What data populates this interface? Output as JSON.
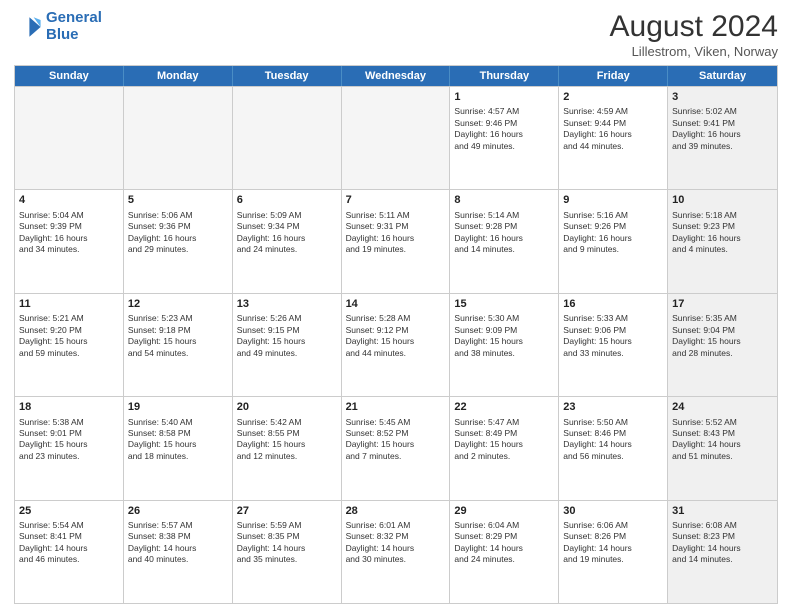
{
  "logo": {
    "line1": "General",
    "line2": "Blue"
  },
  "title": "August 2024",
  "subtitle": "Lillestrom, Viken, Norway",
  "header": {
    "days": [
      "Sunday",
      "Monday",
      "Tuesday",
      "Wednesday",
      "Thursday",
      "Friday",
      "Saturday"
    ]
  },
  "rows": [
    {
      "cells": [
        {
          "day": "",
          "info": "",
          "empty": true
        },
        {
          "day": "",
          "info": "",
          "empty": true
        },
        {
          "day": "",
          "info": "",
          "empty": true
        },
        {
          "day": "",
          "info": "",
          "empty": true
        },
        {
          "day": "1",
          "info": "Sunrise: 4:57 AM\nSunset: 9:46 PM\nDaylight: 16 hours\nand 49 minutes.",
          "empty": false
        },
        {
          "day": "2",
          "info": "Sunrise: 4:59 AM\nSunset: 9:44 PM\nDaylight: 16 hours\nand 44 minutes.",
          "empty": false
        },
        {
          "day": "3",
          "info": "Sunrise: 5:02 AM\nSunset: 9:41 PM\nDaylight: 16 hours\nand 39 minutes.",
          "empty": false,
          "shaded": true
        }
      ]
    },
    {
      "cells": [
        {
          "day": "4",
          "info": "Sunrise: 5:04 AM\nSunset: 9:39 PM\nDaylight: 16 hours\nand 34 minutes.",
          "empty": false
        },
        {
          "day": "5",
          "info": "Sunrise: 5:06 AM\nSunset: 9:36 PM\nDaylight: 16 hours\nand 29 minutes.",
          "empty": false
        },
        {
          "day": "6",
          "info": "Sunrise: 5:09 AM\nSunset: 9:34 PM\nDaylight: 16 hours\nand 24 minutes.",
          "empty": false
        },
        {
          "day": "7",
          "info": "Sunrise: 5:11 AM\nSunset: 9:31 PM\nDaylight: 16 hours\nand 19 minutes.",
          "empty": false
        },
        {
          "day": "8",
          "info": "Sunrise: 5:14 AM\nSunset: 9:28 PM\nDaylight: 16 hours\nand 14 minutes.",
          "empty": false
        },
        {
          "day": "9",
          "info": "Sunrise: 5:16 AM\nSunset: 9:26 PM\nDaylight: 16 hours\nand 9 minutes.",
          "empty": false
        },
        {
          "day": "10",
          "info": "Sunrise: 5:18 AM\nSunset: 9:23 PM\nDaylight: 16 hours\nand 4 minutes.",
          "empty": false,
          "shaded": true
        }
      ]
    },
    {
      "cells": [
        {
          "day": "11",
          "info": "Sunrise: 5:21 AM\nSunset: 9:20 PM\nDaylight: 15 hours\nand 59 minutes.",
          "empty": false
        },
        {
          "day": "12",
          "info": "Sunrise: 5:23 AM\nSunset: 9:18 PM\nDaylight: 15 hours\nand 54 minutes.",
          "empty": false
        },
        {
          "day": "13",
          "info": "Sunrise: 5:26 AM\nSunset: 9:15 PM\nDaylight: 15 hours\nand 49 minutes.",
          "empty": false
        },
        {
          "day": "14",
          "info": "Sunrise: 5:28 AM\nSunset: 9:12 PM\nDaylight: 15 hours\nand 44 minutes.",
          "empty": false
        },
        {
          "day": "15",
          "info": "Sunrise: 5:30 AM\nSunset: 9:09 PM\nDaylight: 15 hours\nand 38 minutes.",
          "empty": false
        },
        {
          "day": "16",
          "info": "Sunrise: 5:33 AM\nSunset: 9:06 PM\nDaylight: 15 hours\nand 33 minutes.",
          "empty": false
        },
        {
          "day": "17",
          "info": "Sunrise: 5:35 AM\nSunset: 9:04 PM\nDaylight: 15 hours\nand 28 minutes.",
          "empty": false,
          "shaded": true
        }
      ]
    },
    {
      "cells": [
        {
          "day": "18",
          "info": "Sunrise: 5:38 AM\nSunset: 9:01 PM\nDaylight: 15 hours\nand 23 minutes.",
          "empty": false
        },
        {
          "day": "19",
          "info": "Sunrise: 5:40 AM\nSunset: 8:58 PM\nDaylight: 15 hours\nand 18 minutes.",
          "empty": false
        },
        {
          "day": "20",
          "info": "Sunrise: 5:42 AM\nSunset: 8:55 PM\nDaylight: 15 hours\nand 12 minutes.",
          "empty": false
        },
        {
          "day": "21",
          "info": "Sunrise: 5:45 AM\nSunset: 8:52 PM\nDaylight: 15 hours\nand 7 minutes.",
          "empty": false
        },
        {
          "day": "22",
          "info": "Sunrise: 5:47 AM\nSunset: 8:49 PM\nDaylight: 15 hours\nand 2 minutes.",
          "empty": false
        },
        {
          "day": "23",
          "info": "Sunrise: 5:50 AM\nSunset: 8:46 PM\nDaylight: 14 hours\nand 56 minutes.",
          "empty": false
        },
        {
          "day": "24",
          "info": "Sunrise: 5:52 AM\nSunset: 8:43 PM\nDaylight: 14 hours\nand 51 minutes.",
          "empty": false,
          "shaded": true
        }
      ]
    },
    {
      "cells": [
        {
          "day": "25",
          "info": "Sunrise: 5:54 AM\nSunset: 8:41 PM\nDaylight: 14 hours\nand 46 minutes.",
          "empty": false
        },
        {
          "day": "26",
          "info": "Sunrise: 5:57 AM\nSunset: 8:38 PM\nDaylight: 14 hours\nand 40 minutes.",
          "empty": false
        },
        {
          "day": "27",
          "info": "Sunrise: 5:59 AM\nSunset: 8:35 PM\nDaylight: 14 hours\nand 35 minutes.",
          "empty": false
        },
        {
          "day": "28",
          "info": "Sunrise: 6:01 AM\nSunset: 8:32 PM\nDaylight: 14 hours\nand 30 minutes.",
          "empty": false
        },
        {
          "day": "29",
          "info": "Sunrise: 6:04 AM\nSunset: 8:29 PM\nDaylight: 14 hours\nand 24 minutes.",
          "empty": false
        },
        {
          "day": "30",
          "info": "Sunrise: 6:06 AM\nSunset: 8:26 PM\nDaylight: 14 hours\nand 19 minutes.",
          "empty": false
        },
        {
          "day": "31",
          "info": "Sunrise: 6:08 AM\nSunset: 8:23 PM\nDaylight: 14 hours\nand 14 minutes.",
          "empty": false,
          "shaded": true
        }
      ]
    }
  ]
}
